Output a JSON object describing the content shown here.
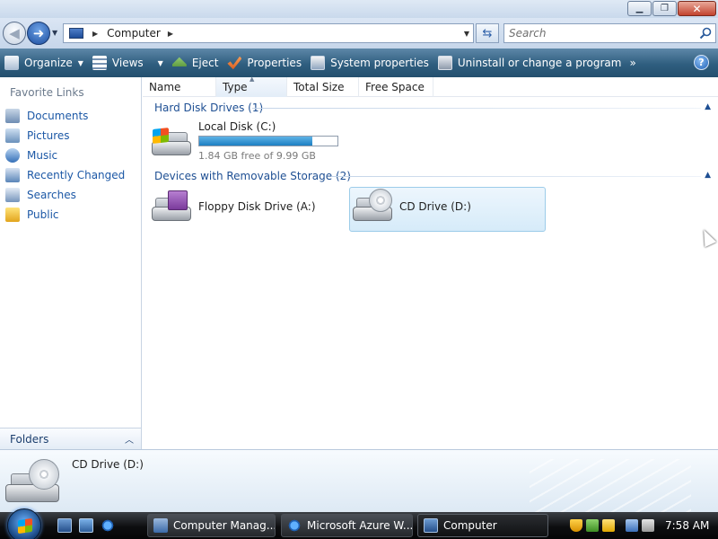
{
  "window": {
    "address": {
      "location": "Computer"
    },
    "search": {
      "placeholder": "Search"
    }
  },
  "command_bar": {
    "organize": "Organize",
    "views": "Views",
    "eject": "Eject",
    "properties": "Properties",
    "system_properties": "System properties",
    "uninstall": "Uninstall or change a program",
    "more": "»",
    "help": "?"
  },
  "nav_pane": {
    "favorites_title": "Favorite Links",
    "items": [
      {
        "label": "Documents",
        "icon": "documents-icon"
      },
      {
        "label": "Pictures",
        "icon": "pictures-icon"
      },
      {
        "label": "Music",
        "icon": "music-icon"
      },
      {
        "label": "Recently Changed",
        "icon": "recently-changed-icon"
      },
      {
        "label": "Searches",
        "icon": "searches-icon"
      },
      {
        "label": "Public",
        "icon": "public-folder-icon"
      }
    ],
    "folders_label": "Folders"
  },
  "columns": [
    "Name",
    "Type",
    "Total Size",
    "Free Space"
  ],
  "groups": {
    "hard_disks": {
      "title": "Hard Disk Drives (1)",
      "drives": [
        {
          "name": "Local Disk (C:)",
          "free_text": "1.84 GB free of 9.99 GB",
          "used_fraction": 0.816
        }
      ]
    },
    "removable": {
      "title": "Devices with Removable Storage (2)",
      "drives": [
        {
          "name": "Floppy Disk Drive (A:)"
        },
        {
          "name": "CD Drive (D:)",
          "selected": true
        }
      ]
    }
  },
  "details": {
    "name": "CD Drive (D:)"
  },
  "taskbar": {
    "buttons": [
      {
        "label": "Computer Manag..."
      },
      {
        "label": "Microsoft Azure W..."
      },
      {
        "label": "Computer",
        "active": true
      }
    ],
    "clock": "7:58 AM"
  },
  "colors": {
    "command_bar": "#2f5e7f",
    "link_blue": "#1c58a6",
    "group_header": "#1e4f93",
    "selection": "#d6ebf9"
  }
}
